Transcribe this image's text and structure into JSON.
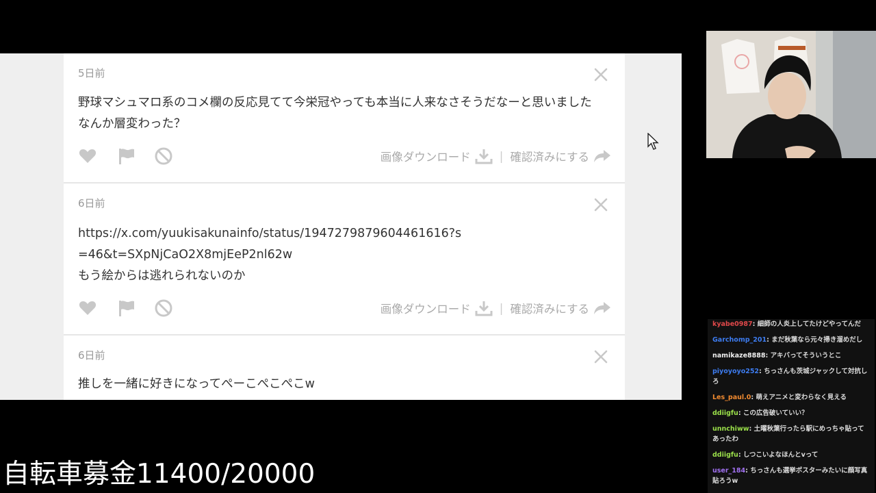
{
  "cards": [
    {
      "time": "5日前",
      "text": "野球マシュマロ系のコメ欄の反応見てて今栄冠やっても本当に人来なさそうだなーと思いました　なんか層変わった？",
      "download_label": "画像ダウンロード",
      "confirm_label": "確認済みにする"
    },
    {
      "time": "6日前",
      "text": "https://x.com/yuukisakunainfo/status/1947279879604461616?s=46&t=SXpNjCaO2X8mjEeP2nl62w\nもう絵からは逃れられないのか",
      "download_label": "画像ダウンロード",
      "confirm_label": "確認済みにする"
    },
    {
      "time": "6日前",
      "text": "推しを一緒に好きになってぺーこぺこぺこw"
    }
  ],
  "chat": [
    {
      "user": "kyabe0987",
      "text": "細師の人炎上してたけどやってんだ",
      "color": "#e0484a"
    },
    {
      "user": "Garchomp_201",
      "text": "まだ秋葉なら元々掃き溜めだし",
      "color": "#3d7cf0"
    },
    {
      "user": "namikaze8888",
      "text": "アキバってそういうとこ",
      "color": "#f0f0f0"
    },
    {
      "user": "piyoyoyo252",
      "text": "ちっさんも茨城ジャックして対抗しろ",
      "color": "#3d7cf0"
    },
    {
      "user": "Les_paul.0",
      "text": "萌えアニメと変わらなく見える",
      "color": "#f08a30"
    },
    {
      "user": "ddiigfu",
      "text": "この広告破いていい？",
      "color": "#9be04a"
    },
    {
      "user": "unnchiww",
      "text": "土曜秋葉行ったら駅にめっちゃ貼ってあったわ",
      "color": "#9be04a"
    },
    {
      "user": "ddiigfu",
      "text": "しつこいよなほんとvって",
      "color": "#9be04a"
    },
    {
      "user": "user_184",
      "text": "ちっさんも選挙ポスターみたいに顔写真貼ろうw",
      "color": "#a070f0"
    }
  ],
  "donation_text": "自転車募金11400/20000",
  "icons": {
    "heart": "heart-icon",
    "flag": "flag-icon",
    "block": "block-icon",
    "download": "download-icon",
    "share": "share-icon",
    "close": "close-icon"
  },
  "colors": {
    "icon_gray": "#c8c8c8",
    "text_gray": "#aaaaaa",
    "panel_bg": "#efefef"
  }
}
